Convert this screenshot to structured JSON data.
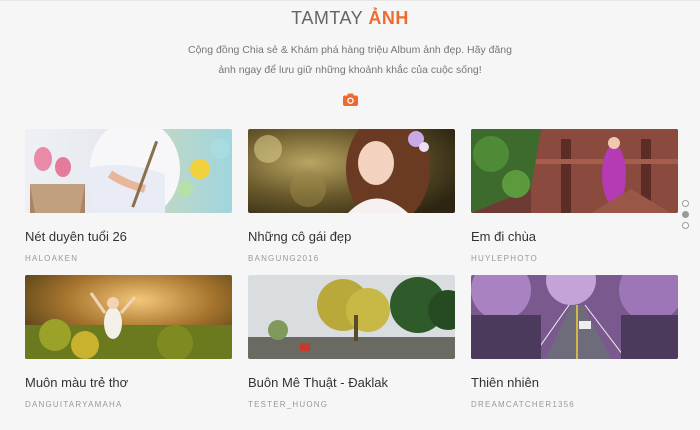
{
  "header": {
    "title_main": "TAMTAY",
    "title_accent": "ẢNH",
    "description_line1": "Cộng đồng Chia sẻ & Khám phá hàng triệu Album ảnh đẹp. Hãy đăng",
    "description_line2": "ảnh ngay để lưu giữ những khoảnh khắc của cuộc sống!",
    "camera_icon": "camera-icon",
    "accent_color": "#ee6b2f"
  },
  "albums": [
    {
      "title": "Nét duyên tuổi 26",
      "author": "HALOAKEN",
      "thumbnail_icon": "photo-woman-lotus"
    },
    {
      "title": "Những cô gái đẹp",
      "author": "BANGUNG2016",
      "thumbnail_icon": "photo-girl-portrait"
    },
    {
      "title": "Em đi chùa",
      "author": "HUYLEPHOTO",
      "thumbnail_icon": "photo-woman-pagoda"
    },
    {
      "title": "Muôn màu trẻ thơ",
      "author": "DANGUITARYAMAHA",
      "thumbnail_icon": "photo-child-field"
    },
    {
      "title": "Buôn Mê Thuật - Đaklak",
      "author": "TESTER_HUONG",
      "thumbnail_icon": "photo-road-trees"
    },
    {
      "title": "Thiên nhiên",
      "author": "DREAMCATCHER1356",
      "thumbnail_icon": "photo-purple-avenue"
    }
  ],
  "pagination": {
    "pages": 3,
    "active_page": 2
  }
}
